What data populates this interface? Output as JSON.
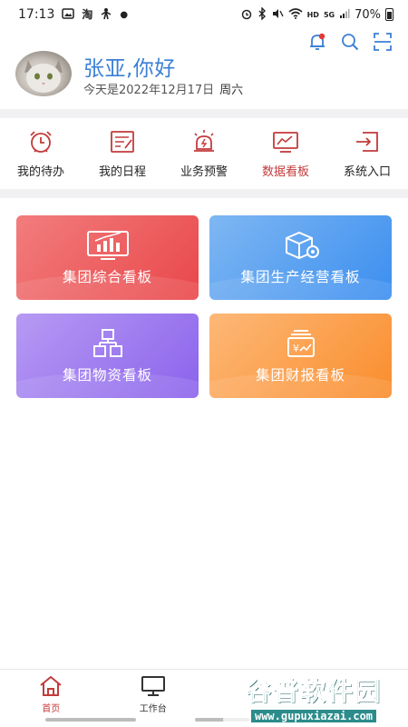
{
  "status_bar": {
    "time": "17:13",
    "battery": "70%",
    "network": "5G",
    "hd": "HD"
  },
  "header": {
    "greeting": "张亚,你好",
    "date_text": "今天是2022年12月17日",
    "weekday": "周六"
  },
  "quick_nav": [
    {
      "label": "我的待办",
      "icon": "alarm-clock-icon",
      "active": false
    },
    {
      "label": "我的日程",
      "icon": "schedule-icon",
      "active": false
    },
    {
      "label": "业务预警",
      "icon": "warning-light-icon",
      "active": false
    },
    {
      "label": "数据看板",
      "icon": "chart-board-icon",
      "active": true
    },
    {
      "label": "系统入口",
      "icon": "entry-icon",
      "active": false
    }
  ],
  "cards": [
    {
      "label": "集团综合看板",
      "icon": "bar-chart-monitor-icon"
    },
    {
      "label": "集团生产经营看板",
      "icon": "box-gear-icon"
    },
    {
      "label": "集团物资看板",
      "icon": "boxes-icon"
    },
    {
      "label": "集团财报看板",
      "icon": "finance-report-icon"
    }
  ],
  "bottom_nav": [
    {
      "label": "首页",
      "icon": "home-icon",
      "active": true
    },
    {
      "label": "工作台",
      "icon": "desktop-icon",
      "active": false
    },
    {
      "label": "",
      "icon": "",
      "active": false
    },
    {
      "label": "",
      "icon": "",
      "active": false
    }
  ],
  "watermark": {
    "title": "谷普软件园",
    "url": "www.gupuxiazai.com"
  },
  "colors": {
    "accent_blue": "#3a7fd4",
    "accent_red": "#c33b3b",
    "card_red": "#e9474a",
    "card_blue": "#3b8ef0",
    "card_purple": "#8b63ec",
    "card_orange": "#fa8d2d"
  }
}
